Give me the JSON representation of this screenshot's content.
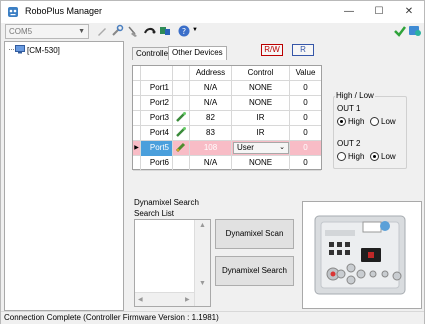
{
  "window": {
    "title": "RoboPlus Manager",
    "buttons": {
      "minimize": "—",
      "maximize": "☐",
      "close": "✕"
    }
  },
  "toolbar": {
    "port_select": "COM5",
    "icons": [
      "pencil-icon",
      "wrench-icon",
      "broom-icon",
      "connect-icon",
      "download-icon",
      "help-icon",
      "check-icon",
      "firmware-icon"
    ]
  },
  "tree": {
    "node_label": "[CM-530]"
  },
  "tabs": {
    "controller": "Controller",
    "other_devices": "Other Devices"
  },
  "rw_buttons": {
    "rw": "R/W",
    "r": "R"
  },
  "grid": {
    "columns": [
      "Address",
      "Control",
      "Value"
    ],
    "rows": [
      {
        "name": "Port1",
        "address": "N/A",
        "control": "NONE",
        "value": "0",
        "icon": "",
        "selected": false
      },
      {
        "name": "Port2",
        "address": "N/A",
        "control": "NONE",
        "value": "0",
        "icon": "",
        "selected": false
      },
      {
        "name": "Port3",
        "address": "82",
        "control": "IR",
        "value": "0",
        "icon": "ir-sensor-icon",
        "selected": false
      },
      {
        "name": "Port4",
        "address": "83",
        "control": "IR",
        "value": "0",
        "icon": "ir-sensor-icon",
        "selected": false
      },
      {
        "name": "Port5",
        "address": "108",
        "control": "User",
        "value": "0",
        "icon": "user-device-icon",
        "selected": true
      },
      {
        "name": "Port6",
        "address": "N/A",
        "control": "NONE",
        "value": "0",
        "icon": "",
        "selected": false
      }
    ]
  },
  "high_low": {
    "title": "High / Low",
    "out1": {
      "label": "OUT 1",
      "high": "High",
      "low": "Low",
      "selected": "High"
    },
    "out2": {
      "label": "OUT 2",
      "high": "High",
      "low": "Low",
      "selected": "Low"
    }
  },
  "dynamixel": {
    "group_label": "Dynamixel Search",
    "list_label": "Search List",
    "scan_button": "Dynamixel Scan",
    "search_button": "Dynamixel Search"
  },
  "status": {
    "text": "Connection Complete (Controller Firmware Version : 1.1981)"
  },
  "colors": {
    "selected_row": "#f8bcc6",
    "selected_name": "#4a9fdc",
    "rw_red": "#b00000",
    "r_blue": "#3656a8"
  }
}
